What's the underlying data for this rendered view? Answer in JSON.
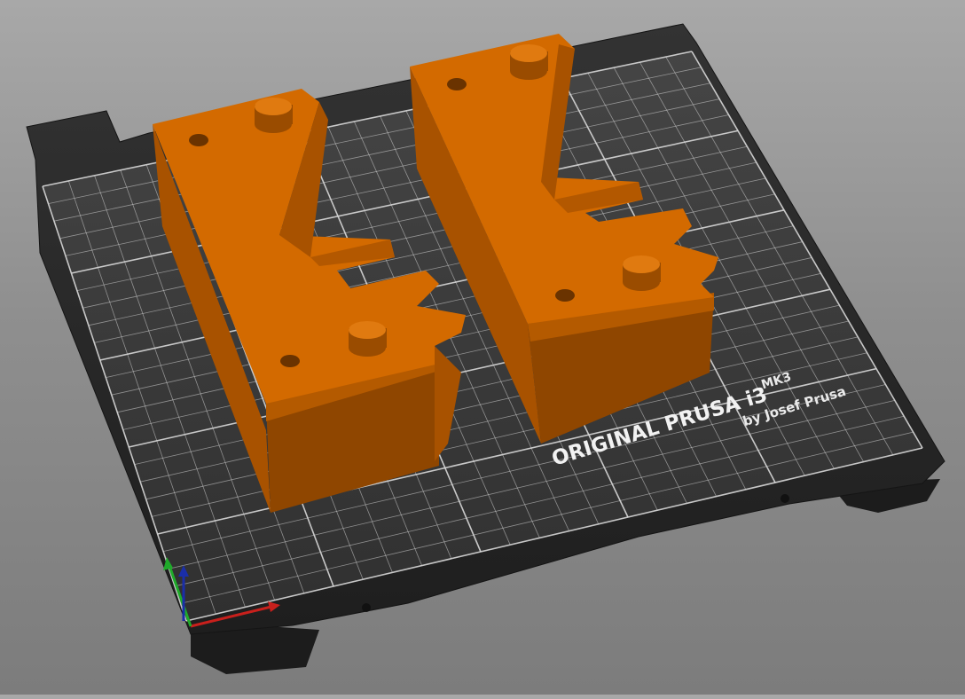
{
  "bed": {
    "brand": "ORIGINAL PRUSA i3",
    "model": "MK3",
    "byline": "by Josef Prusa",
    "surface_color": "#3a3a3a",
    "frame_color": "#2b2b2b",
    "grid_color": "#e6e6e6"
  },
  "parts": {
    "color_top": "#d36a00",
    "color_side": "#a85200",
    "color_dark": "#7a3c00",
    "count": 2
  },
  "axes": {
    "x_color": "#c8201c",
    "y_color": "#1faa2a",
    "z_color": "#1a2ea8",
    "icon": "axes-gizmo-icon"
  }
}
